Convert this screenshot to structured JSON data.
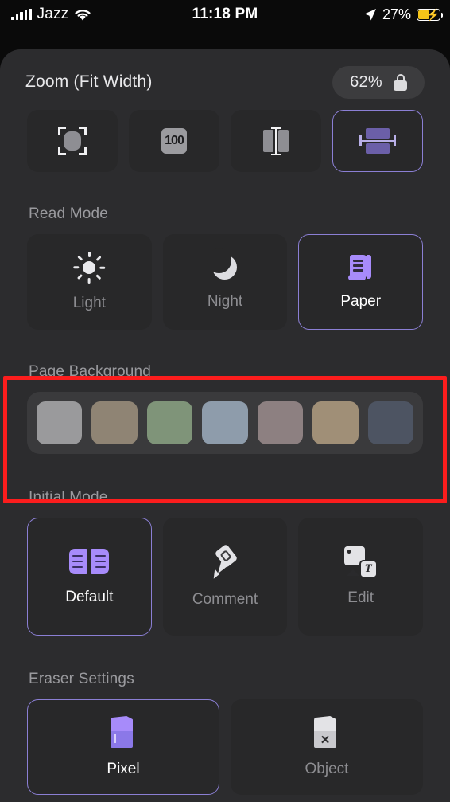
{
  "status_bar": {
    "carrier": "Jazz",
    "time": "11:18 PM",
    "battery_percent": "27%",
    "signal_icon": "signal-bars-icon",
    "wifi_icon": "wifi-icon",
    "location_icon": "location-arrow-icon",
    "battery_icon": "battery-charging-icon"
  },
  "toolbar": {
    "icons": [
      {
        "name": "home-icon"
      },
      {
        "name": "avatar-icon"
      },
      {
        "name": "highlighter-icon"
      },
      {
        "name": "media-icon"
      },
      {
        "name": "ai-sparkle-icon"
      },
      {
        "name": "pages-icon"
      }
    ]
  },
  "sheet": {
    "zoom": {
      "title": "Zoom (Fit Width)",
      "value": "62%",
      "lock_icon": "lock-closed-icon",
      "options": [
        {
          "label": "",
          "icon": "fit-page-icon",
          "selected": false
        },
        {
          "label": "",
          "icon": "zoom-100-icon",
          "selected": false
        },
        {
          "label": "",
          "icon": "fit-height-icon",
          "selected": false
        },
        {
          "label": "",
          "icon": "fit-width-icon",
          "selected": true
        }
      ]
    },
    "read_mode": {
      "label": "Read Mode",
      "options": [
        {
          "label": "Light",
          "icon": "sun-icon",
          "selected": false
        },
        {
          "label": "Night",
          "icon": "moon-icon",
          "selected": false
        },
        {
          "label": "Paper",
          "icon": "scroll-icon",
          "selected": true
        }
      ]
    },
    "page_background": {
      "label": "Page Background",
      "swatches": [
        {
          "name": "swatch-gray",
          "color": "#9a9a9c"
        },
        {
          "name": "swatch-khaki",
          "color": "#8f8474"
        },
        {
          "name": "swatch-sage",
          "color": "#7f9479"
        },
        {
          "name": "swatch-blue-gray",
          "color": "#8e9cab"
        },
        {
          "name": "swatch-mauve",
          "color": "#8d8081"
        },
        {
          "name": "swatch-tan",
          "color": "#a08f77"
        },
        {
          "name": "swatch-slate",
          "color": "#4d5462"
        }
      ],
      "highlight_color": "#fc1d1d"
    },
    "initial_mode": {
      "label": "Initial Mode",
      "options": [
        {
          "label": "Default",
          "icon": "open-book-icon",
          "selected": true
        },
        {
          "label": "Comment",
          "icon": "highlighter-marker-icon",
          "selected": false
        },
        {
          "label": "Edit",
          "icon": "image-text-icon",
          "selected": false
        }
      ]
    },
    "eraser_settings": {
      "label": "Eraser Settings",
      "options": [
        {
          "label": "Pixel",
          "icon": "eraser-pixel-icon",
          "selected": true
        },
        {
          "label": "Object",
          "icon": "eraser-object-icon",
          "selected": false
        }
      ]
    }
  },
  "theme": {
    "accent": "#a78bfa",
    "selected_border": "#8b7fd4",
    "sheet_bg": "#2c2c2e",
    "card_bg": "#282829"
  }
}
